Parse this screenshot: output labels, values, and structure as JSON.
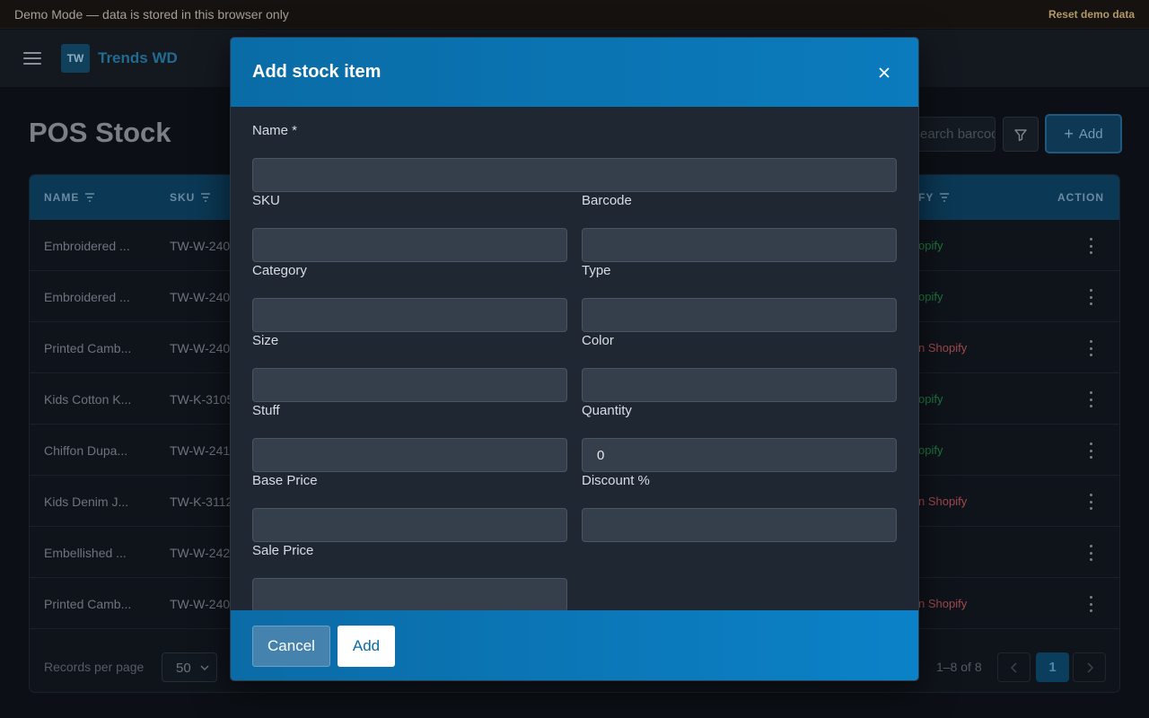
{
  "demo_bar": {
    "message": "Demo Mode — data is stored in this browser only",
    "reset": "Reset demo data"
  },
  "nav": {
    "logo": "TW",
    "brand": "Trends WD"
  },
  "page": {
    "title": "POS Stock",
    "search_placeholder": "Search barcode..",
    "add_label": "Add"
  },
  "table": {
    "headers": {
      "name": "NAME",
      "sku": "SKU",
      "shopify": "FY",
      "action": "ACTION"
    },
    "rows": [
      {
        "name": "Embroidered ...",
        "sku": "TW-W-240",
        "shopify": "opify",
        "status": "ok"
      },
      {
        "name": "Embroidered ...",
        "sku": "TW-W-240",
        "shopify": "opify",
        "status": "ok"
      },
      {
        "name": "Printed Camb...",
        "sku": "TW-W-240",
        "shopify": "n Shopify",
        "status": "missing"
      },
      {
        "name": "Kids Cotton K...",
        "sku": "TW-K-3105",
        "shopify": "opify",
        "status": "ok"
      },
      {
        "name": "Chiffon Dupa...",
        "sku": "TW-W-241",
        "shopify": "opify",
        "status": "ok"
      },
      {
        "name": "Kids Denim J...",
        "sku": "TW-K-3112",
        "shopify": "n Shopify",
        "status": "missing"
      },
      {
        "name": "Embellished ...",
        "sku": "TW-W-242",
        "shopify": "",
        "status": "none"
      },
      {
        "name": "Printed Camb...",
        "sku": "TW-W-240",
        "shopify": "n Shopify",
        "status": "missing"
      }
    ],
    "footer": {
      "records_per_page": "Records per page",
      "per_page_value": "50",
      "range": "1–8 of 8",
      "current_page": "1"
    }
  },
  "colors": {
    "ok": "#1f7a3f",
    "missing": "#a3494b",
    "accent": "#0b7bbd"
  },
  "modal": {
    "title": "Add stock item",
    "fields": {
      "name": {
        "label": "Name *",
        "value": ""
      },
      "sku": {
        "label": "SKU",
        "value": ""
      },
      "barcode": {
        "label": "Barcode",
        "value": ""
      },
      "category": {
        "label": "Category",
        "value": ""
      },
      "type": {
        "label": "Type",
        "value": ""
      },
      "size": {
        "label": "Size",
        "value": ""
      },
      "color": {
        "label": "Color",
        "value": ""
      },
      "stuff": {
        "label": "Stuff",
        "value": ""
      },
      "quantity": {
        "label": "Quantity",
        "value": "0"
      },
      "base_price": {
        "label": "Base Price",
        "value": ""
      },
      "discount": {
        "label": "Discount %",
        "value": ""
      },
      "sale_price": {
        "label": "Sale Price",
        "value": ""
      }
    },
    "cancel_label": "Cancel",
    "add_label": "Add"
  }
}
